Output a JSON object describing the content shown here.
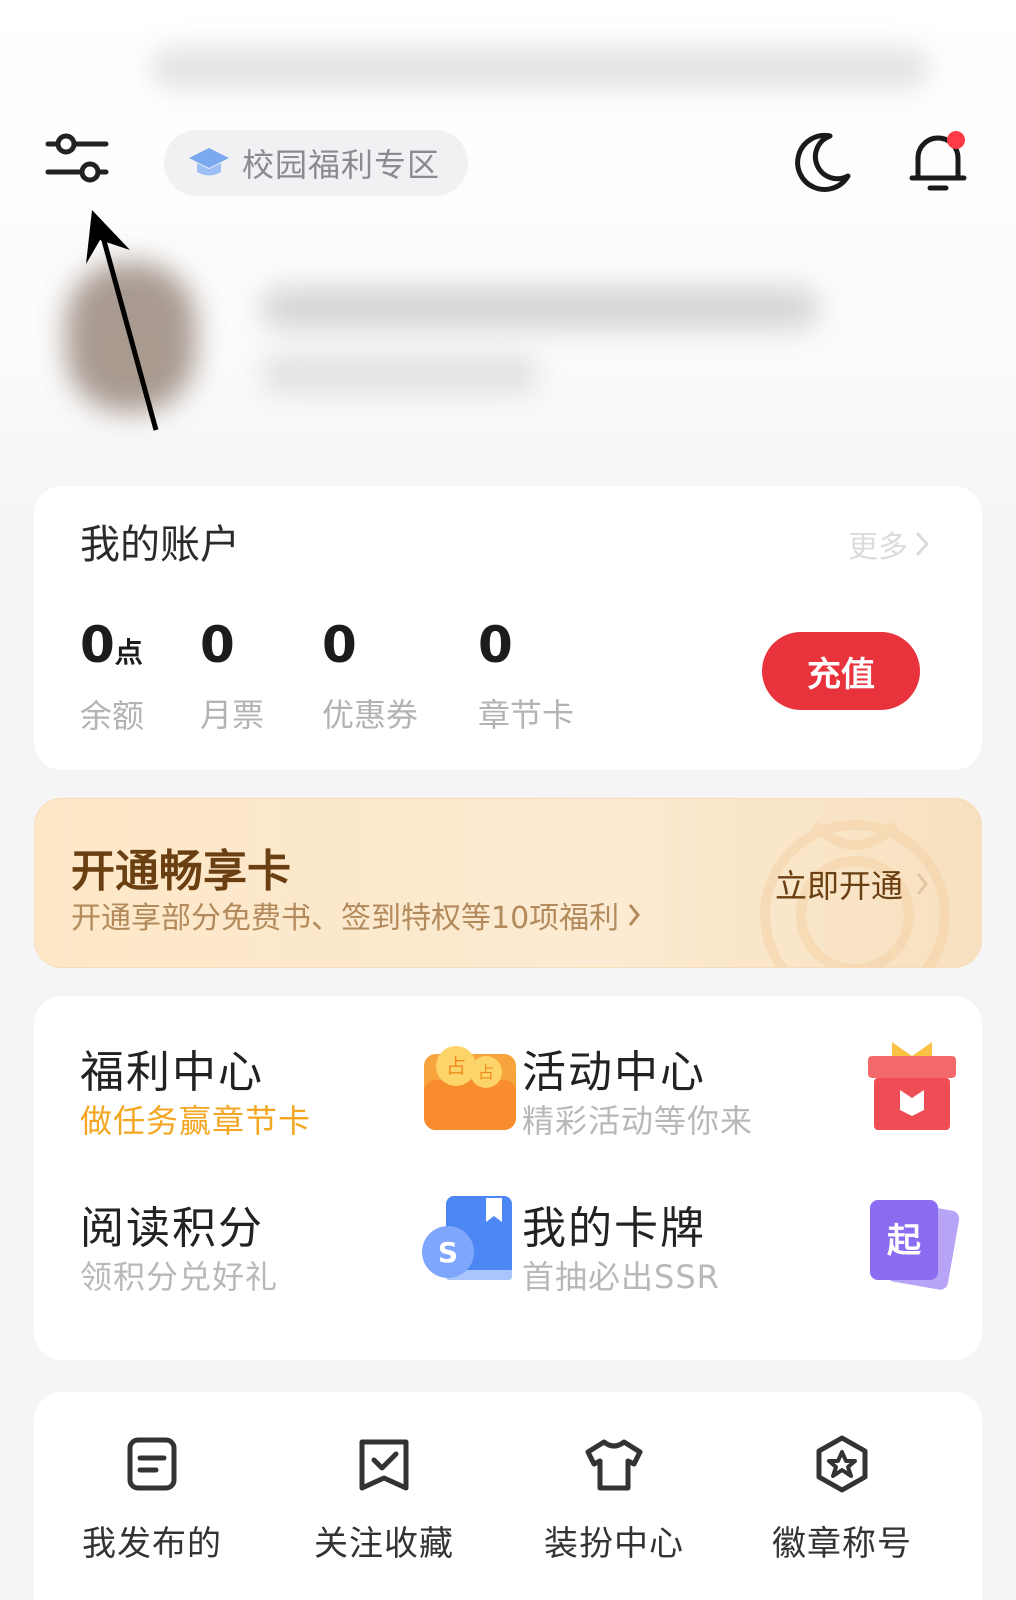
{
  "header": {
    "campus_label": "校园福利专区",
    "icons": [
      "filter-icon",
      "graduation-cap-icon",
      "moon-icon",
      "bell-icon"
    ],
    "bell_has_badge": true
  },
  "account": {
    "title": "我的账户",
    "more_label": "更多",
    "stats": [
      {
        "value": "0",
        "unit": "点",
        "label": "余额"
      },
      {
        "value": "0",
        "unit": "",
        "label": "月票"
      },
      {
        "value": "0",
        "unit": "",
        "label": "优惠券"
      },
      {
        "value": "0",
        "unit": "",
        "label": "章节卡"
      }
    ],
    "recharge_label": "充值"
  },
  "vip": {
    "title": "开通畅享卡",
    "subtitle": "开通享部分免费书、签到特权等10项福利",
    "open_label": "立即开通"
  },
  "grid": [
    {
      "title": "福利中心",
      "subtitle": "做任务赢章节卡",
      "icon": "coin-wallet-icon"
    },
    {
      "title": "活动中心",
      "subtitle": "精彩活动等你来",
      "icon": "gift-box-icon"
    },
    {
      "title": "阅读积分",
      "subtitle": "领积分兑好礼",
      "icon": "book-points-icon"
    },
    {
      "title": "我的卡牌",
      "subtitle": "首抽必出SSR",
      "icon": "card-deck-icon",
      "icon_text": "起"
    }
  ],
  "tools": [
    {
      "label": "我发布的",
      "icon": "document-icon"
    },
    {
      "label": "关注收藏",
      "icon": "check-bookmark-icon"
    },
    {
      "label": "装扮中心",
      "icon": "tshirt-icon"
    },
    {
      "label": "徽章称号",
      "icon": "badge-star-icon"
    }
  ],
  "colors": {
    "accent_red": "#e8323c",
    "vip_brown": "#6a3f12",
    "orange_text": "#f4a621"
  }
}
